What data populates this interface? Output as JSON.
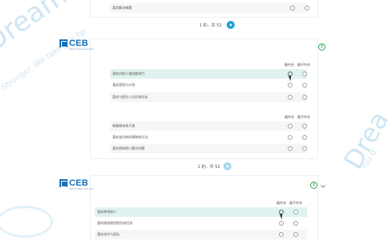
{
  "top_section": {
    "last_row": {
      "statement": "喜欢解决难题"
    },
    "pager_text": "1 的，共 52"
  },
  "page2": {
    "logo": "CEB",
    "logo_sub": "Talent Measurement",
    "help": "?",
    "group1": {
      "col_most": "最符合",
      "col_least": "最不符合",
      "rows": [
        {
          "statement": "喜欢对他人施加影响力"
        },
        {
          "statement": "喜欢规划与计划"
        },
        {
          "statement": "喜欢与陌生人交往和交际"
        }
      ]
    },
    "group2": {
      "col_most": "最符合",
      "col_least": "最不符合",
      "rows": [
        {
          "statement": "做事情有条不紊"
        },
        {
          "statement": "喜欢尝试新的事物和方法"
        },
        {
          "statement": "喜欢帮助他人解决问题"
        }
      ]
    },
    "pager_text": "2 的，共 52"
  },
  "page3": {
    "logo": "CEB",
    "logo_sub": "Talent Measurement",
    "help": "?",
    "group1": {
      "col_most": "最符合",
      "col_least": "最不符合",
      "rows": [
        {
          "statement": "喜欢带领他人"
        },
        {
          "statement": "喜欢按部就班地完成任务"
        },
        {
          "statement": "喜欢合作与团队"
        }
      ]
    }
  },
  "watermark": {
    "left_large": "DreamCareer",
    "left_small": "Stronger. We take you far",
    "right_large": "Drea",
    "right_small": "You d"
  }
}
